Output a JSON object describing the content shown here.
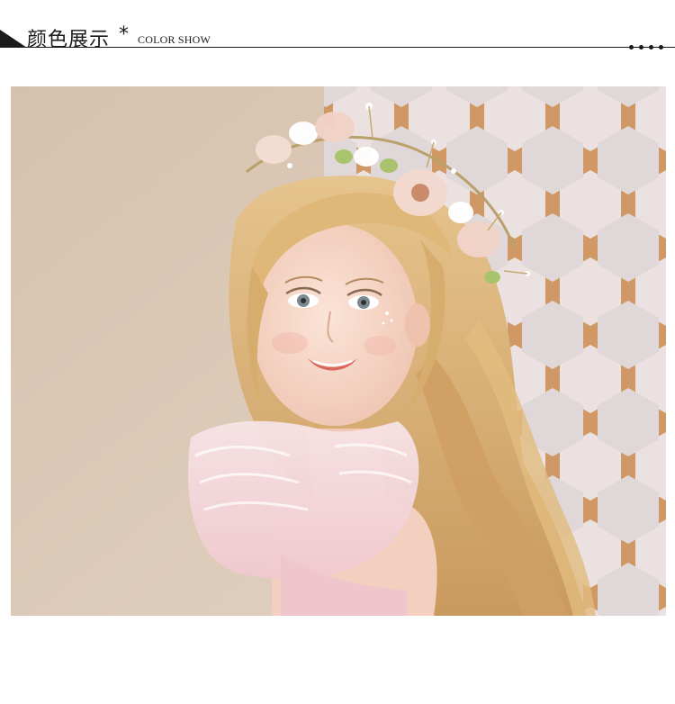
{
  "header": {
    "title": "颜色展示",
    "star": "*",
    "subtitle": "COLOR SHOW",
    "dot_count": 4
  },
  "photo": {
    "subject": "product-photo-flower-crown",
    "colors": {
      "wall": "#dac7b4",
      "screen_wood": "#c8874a",
      "hair": "#d9b27a",
      "skin": "#f6d8c8",
      "dress": "#f4d3d7",
      "flowers": "#f3dcd2"
    }
  }
}
